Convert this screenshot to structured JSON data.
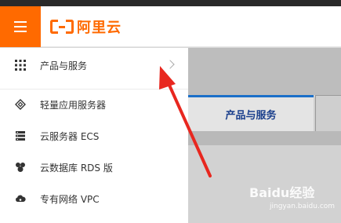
{
  "header": {
    "logo_text": "阿里云"
  },
  "drawer": {
    "items": [
      {
        "label": "产品与服务",
        "icon": "grid-icon"
      },
      {
        "label": "轻量应用服务器",
        "icon": "layers-icon"
      },
      {
        "label": "云服务器 ECS",
        "icon": "server-icon"
      },
      {
        "label": "云数据库 RDS 版",
        "icon": "database-icon"
      },
      {
        "label": "专有网络 VPC",
        "icon": "cloud-network-icon"
      }
    ]
  },
  "background": {
    "tab_label": "产品与服务"
  },
  "watermark": {
    "brand": "Baidu经验",
    "url": "jingyan.baidu.com"
  },
  "colors": {
    "accent": "#ff6a00",
    "arrow": "#e8271f",
    "tab_border": "#1b6fc8"
  }
}
